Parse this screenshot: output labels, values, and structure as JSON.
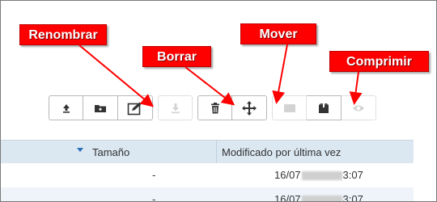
{
  "callouts": {
    "rename": "Renombrar",
    "delete": "Borrar",
    "move": "Mover",
    "compress": "Comprimir"
  },
  "toolbar": {
    "icons": [
      "upload-icon",
      "new-folder-icon",
      "rename-icon",
      "download-icon",
      "trash-icon",
      "move-icon",
      "archive-icon",
      "compress-icon",
      "preview-icon"
    ]
  },
  "table": {
    "headers": {
      "size": "Tamaño",
      "modified": "Modificado por última vez"
    },
    "rows": [
      {
        "size": "-",
        "date_start": "16/07",
        "date_end": "3:07"
      },
      {
        "size": "-",
        "date_start": "16/07",
        "date_end": "3:07"
      }
    ]
  },
  "colors": {
    "callout": "#ff0000",
    "header_bg": "#dbe7f1",
    "sort_arrow": "#2a6ebb"
  }
}
